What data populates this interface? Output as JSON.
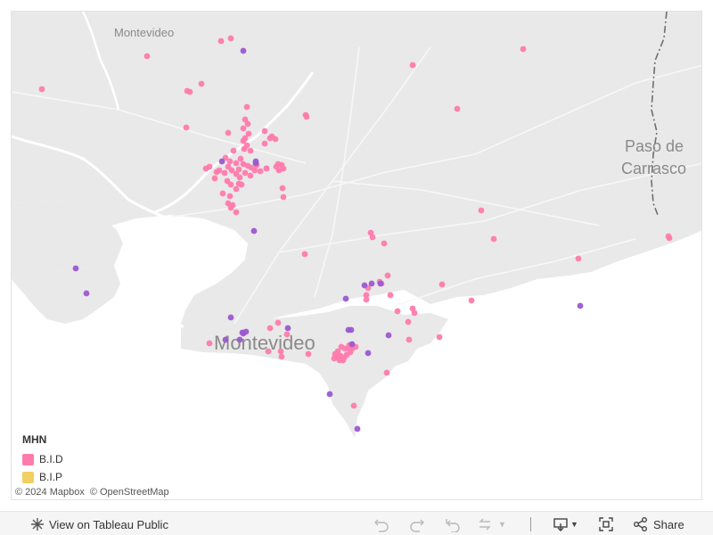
{
  "map": {
    "labels": {
      "city_top": "Montevideo",
      "city_center": "Montevideo",
      "paso_line1": "Paso de",
      "paso_line2": "Carrasco"
    },
    "legend": {
      "title": "MHN",
      "items": [
        {
          "label": "B.I.D",
          "color": "#ff7bac"
        },
        {
          "label": "B.I.P",
          "color": "#f1cf63"
        }
      ]
    },
    "attribution": {
      "mapbox": "© 2024 Mapbox",
      "osm": "© OpenStreetMap"
    },
    "colors": {
      "land": "#e9e9e9",
      "water": "#ffffff",
      "bid": "#ff7bac",
      "bip": "#f1cf63",
      "other": "#9c59d1"
    }
  },
  "toolbar": {
    "view_label": "View on Tableau Public",
    "share_label": "Share",
    "icons": [
      "tableau-logo-icon",
      "undo-icon",
      "redo-icon",
      "revert-icon",
      "refresh-icon",
      "download-icon",
      "fullscreen-icon",
      "share-icon"
    ]
  }
}
